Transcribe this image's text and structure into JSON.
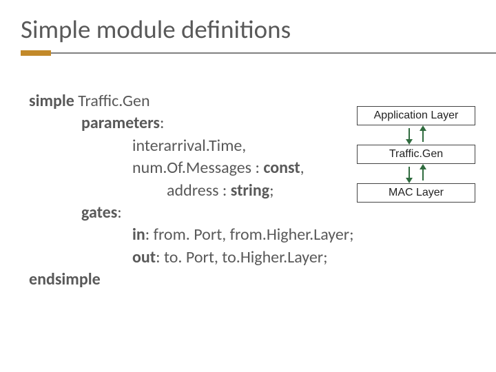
{
  "title": "Simple module definitions",
  "code": {
    "l1_kw": "simple",
    "l1_txt": " Traffic.Gen",
    "l2_kw": "parameters",
    "l2_txt": ":",
    "l3": "interarrival.Time,",
    "l4a": "num.Of.Messages : ",
    "l4b_kw": "const",
    "l4c": ",",
    "l5a": "address : ",
    "l5b_kw": "string",
    "l5c": ";",
    "l6_kw": "gates",
    "l6_txt": ":",
    "l7_kw": "in",
    "l7_txt": ": from. Port, from.Higher.Layer;",
    "l8_kw": "out",
    "l8_txt": ": to. Port, to.Higher.Layer;",
    "l9_kw": "endsimple"
  },
  "diagram": {
    "box1": "Application Layer",
    "box2": "Traffic.Gen",
    "box3": "MAC Layer"
  }
}
